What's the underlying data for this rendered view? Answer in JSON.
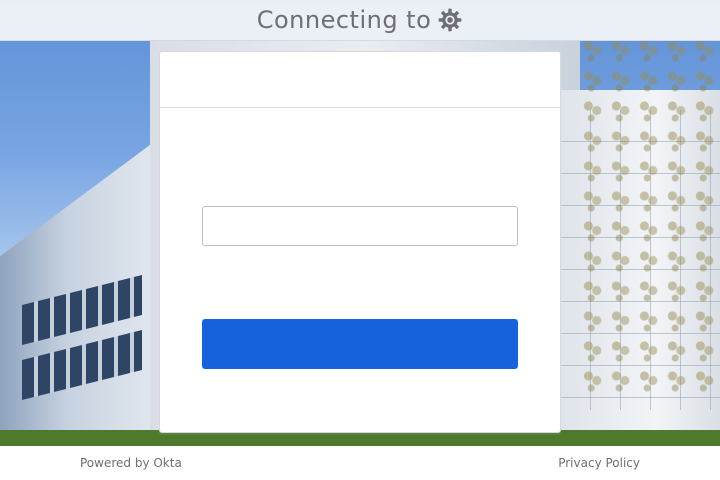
{
  "header": {
    "title": "Connecting to",
    "app_icon": "gear-icon"
  },
  "login_form": {
    "username_value": "",
    "username_placeholder": "",
    "submit_label": ""
  },
  "footer": {
    "powered_by": "Powered by Okta",
    "privacy_policy": "Privacy Policy"
  },
  "colors": {
    "primary_button": "#1662dd",
    "header_background": "#f0f2f7",
    "header_text": "#6e6e78"
  }
}
